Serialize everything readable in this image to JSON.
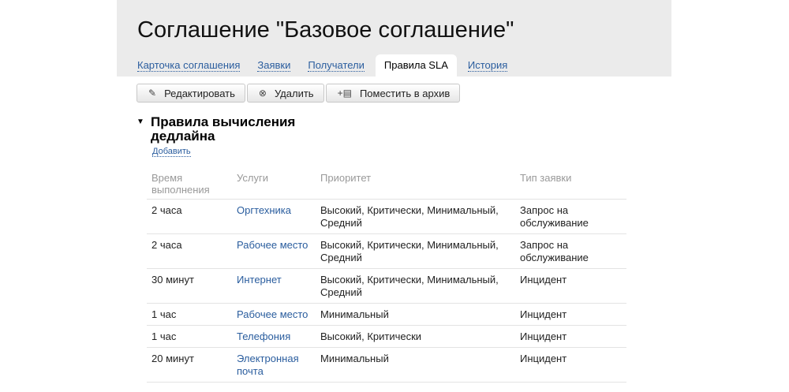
{
  "title": "Соглашение \"Базовое соглашение\"",
  "tabs": [
    {
      "label": "Карточка соглашения"
    },
    {
      "label": "Заявки"
    },
    {
      "label": "Получатели"
    },
    {
      "label": "Правила SLA",
      "active": true
    },
    {
      "label": "История"
    }
  ],
  "toolbar": {
    "edit": "Редактировать",
    "delete": "Удалить",
    "archive": "Поместить в архив"
  },
  "section": {
    "title": "Правила вычисления дедлайна",
    "add": "Добавить"
  },
  "table": {
    "headers": [
      "Время выполнения",
      "Услуги",
      "Приоритет",
      "Тип заявки"
    ],
    "rows": [
      [
        "2 часа",
        "Оргтехника",
        "Высокий, Критически, Минимальный, Средний",
        "Запрос на обслуживание"
      ],
      [
        "2 часа",
        "Рабочее место",
        "Высокий, Критически, Минимальный, Средний",
        "Запрос на обслуживание"
      ],
      [
        "30 минут",
        "Интернет",
        "Высокий, Критически, Минимальный, Средний",
        "Инцидент"
      ],
      [
        "1 час",
        "Рабочее место",
        "Минимальный",
        "Инцидент"
      ],
      [
        "1 час",
        "Телефония",
        "Высокий, Критически",
        "Инцидент"
      ],
      [
        "20 минут",
        "Электронная почта",
        "Минимальный",
        "Инцидент"
      ]
    ]
  }
}
